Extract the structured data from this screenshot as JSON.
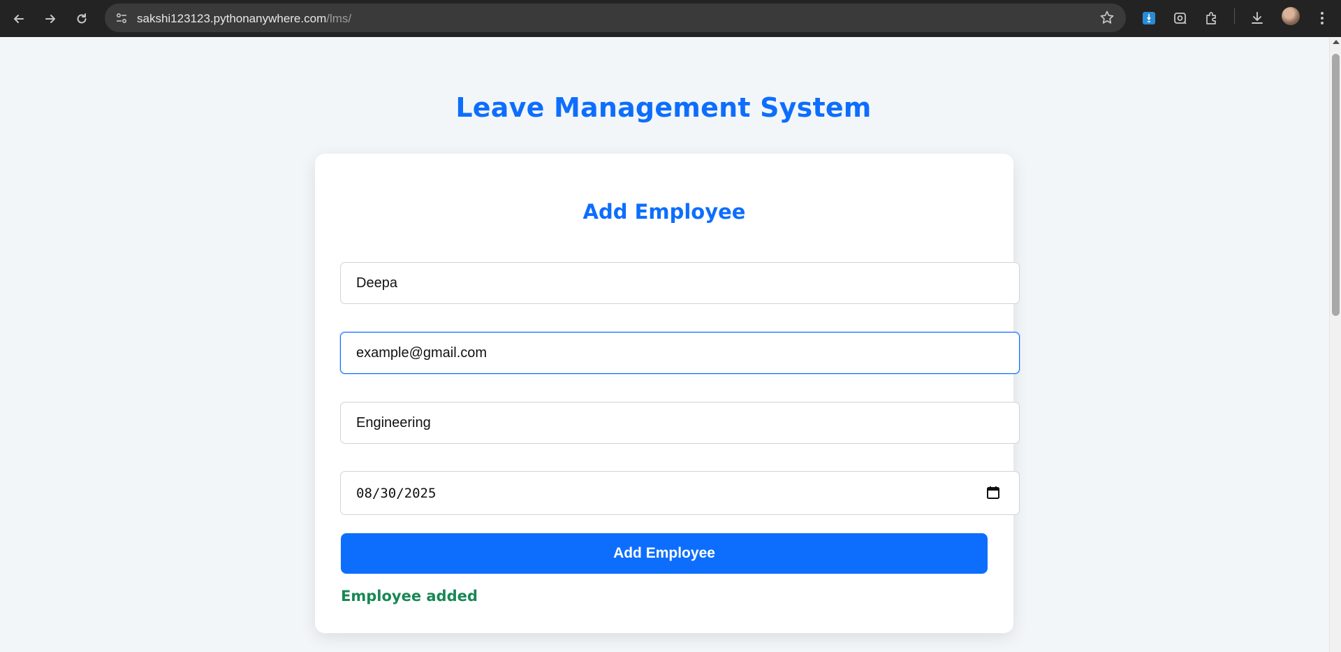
{
  "browser": {
    "url_host": "sakshi123123.pythonanywhere.com",
    "url_path": "/lms/"
  },
  "page": {
    "title": "Leave Management System"
  },
  "form": {
    "title": "Add Employee",
    "name_value": "Deepa",
    "email_value": "example@gmail.com",
    "department_value": "Engineering",
    "date_value": "08/30/2025",
    "submit_label": "Add Employee",
    "status_message": "Employee added"
  },
  "colors": {
    "accent": "#0d6efd",
    "success": "#198754",
    "page_background": "#f3f6f9"
  }
}
